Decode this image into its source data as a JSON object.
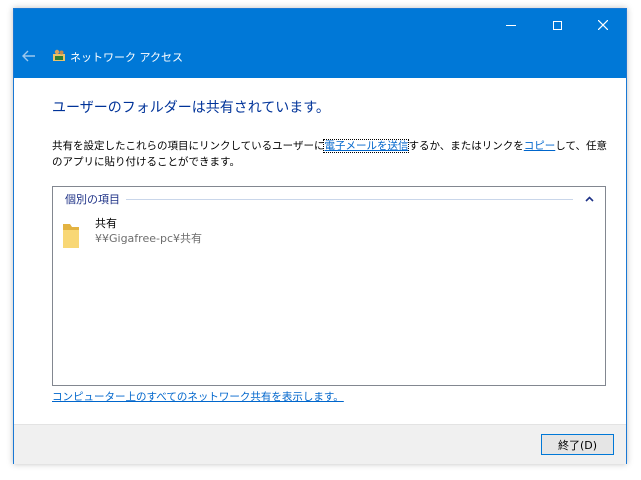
{
  "titlebar": {
    "title": "ネットワーク アクセス",
    "back_icon": "arrow-left-icon",
    "app_icon": "network-users-icon",
    "controls": {
      "minimize": "minimize-icon",
      "maximize": "maximize-icon",
      "close": "close-icon"
    }
  },
  "main": {
    "heading": "ユーザーのフォルダーは共有されています。",
    "description": {
      "part1": "共有を設定したこれらの項目にリンクしているユーザーに",
      "email_link": "電子メールを送信",
      "part2": "するか、またはリンクを",
      "copy_link": "コピー",
      "part3": "して、任意のアプリに貼り付けることができます。"
    },
    "panel": {
      "group_label": "個別の項目",
      "items": [
        {
          "name": "共有",
          "path": "¥¥Gigafree-pc¥共有",
          "icon": "folder-icon"
        }
      ]
    },
    "show_all_link": "コンピューター上のすべてのネットワーク共有を表示します。"
  },
  "footer": {
    "finish_button": "終了(D)"
  },
  "colors": {
    "titlebar": "#0078d7",
    "heading": "#003399",
    "link": "#0066cc"
  }
}
